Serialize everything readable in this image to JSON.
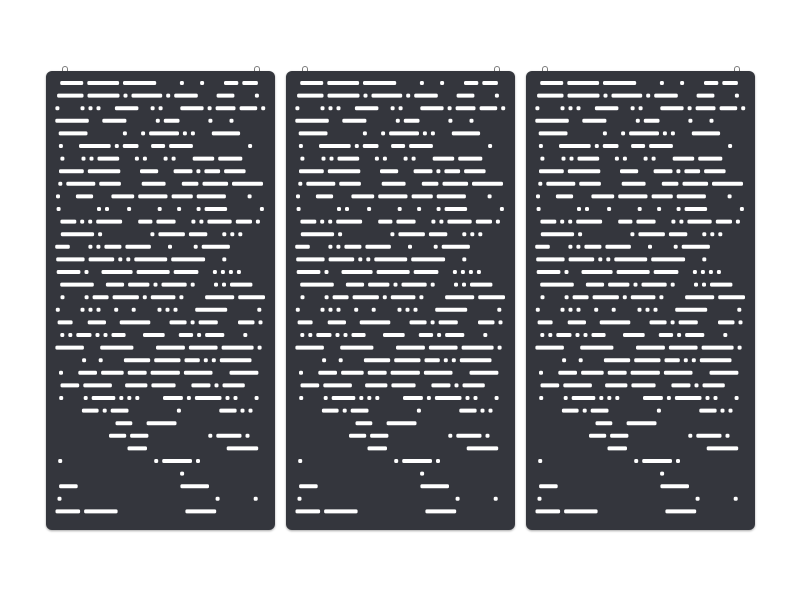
{
  "scene": {
    "subject": "three-hanging-acoustic-felt-panels",
    "panel_count": 3,
    "background_color": "#ffffff",
    "panel_color": "#34363d",
    "cutout_color": "#ffffff",
    "hardware_color": "#7a7a7a",
    "pattern": "morse-code-dots-and-dashes"
  }
}
